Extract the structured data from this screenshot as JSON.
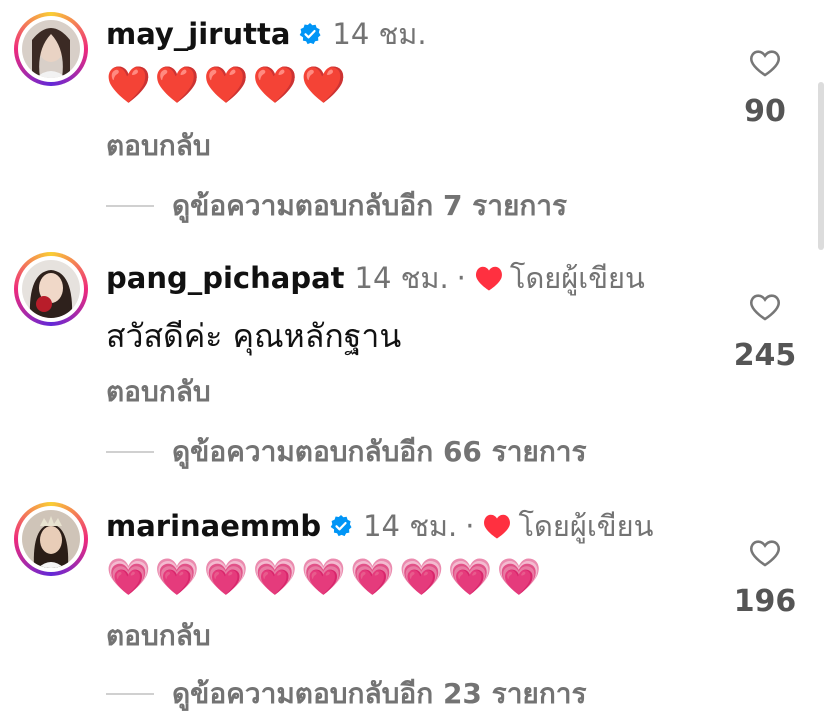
{
  "comments": [
    {
      "username": "may_jirutta",
      "verified": true,
      "time": "14 ชม.",
      "liked_by_author": false,
      "by_author_label": "",
      "content": "❤️❤️❤️❤️❤️",
      "content_is_emoji": true,
      "reply_label": "ตอบกลับ",
      "view_replies": "ดูข้อความตอบกลับอีก 7 รายการ",
      "like_count": "90"
    },
    {
      "username": "pang_pichapat",
      "verified": false,
      "time": "14 ชม.",
      "liked_by_author": true,
      "by_author_label": "โดยผู้เขียน",
      "content": "สวัสดีค่ะ คุณหลักฐาน",
      "content_is_emoji": false,
      "reply_label": "ตอบกลับ",
      "view_replies": "ดูข้อความตอบกลับอีก 66 รายการ",
      "like_count": "245"
    },
    {
      "username": "marinaemmb",
      "verified": true,
      "time": "14 ชม.",
      "liked_by_author": true,
      "by_author_label": "โดยผู้เขียน",
      "content": "💗💗💗💗💗💗💗💗💗",
      "content_is_emoji": true,
      "reply_label": "ตอบกลับ",
      "view_replies": "ดูข้อความตอบกลับอีก 23 รายการ",
      "like_count": "196"
    }
  ],
  "separator": "·",
  "icons": {
    "verified": "verified-badge-icon",
    "author_like": "red-heart-icon",
    "like": "heart-outline-icon"
  },
  "colors": {
    "verified_blue": "#0095f6",
    "heart_red": "#ff3040",
    "muted_text": "#737373"
  }
}
